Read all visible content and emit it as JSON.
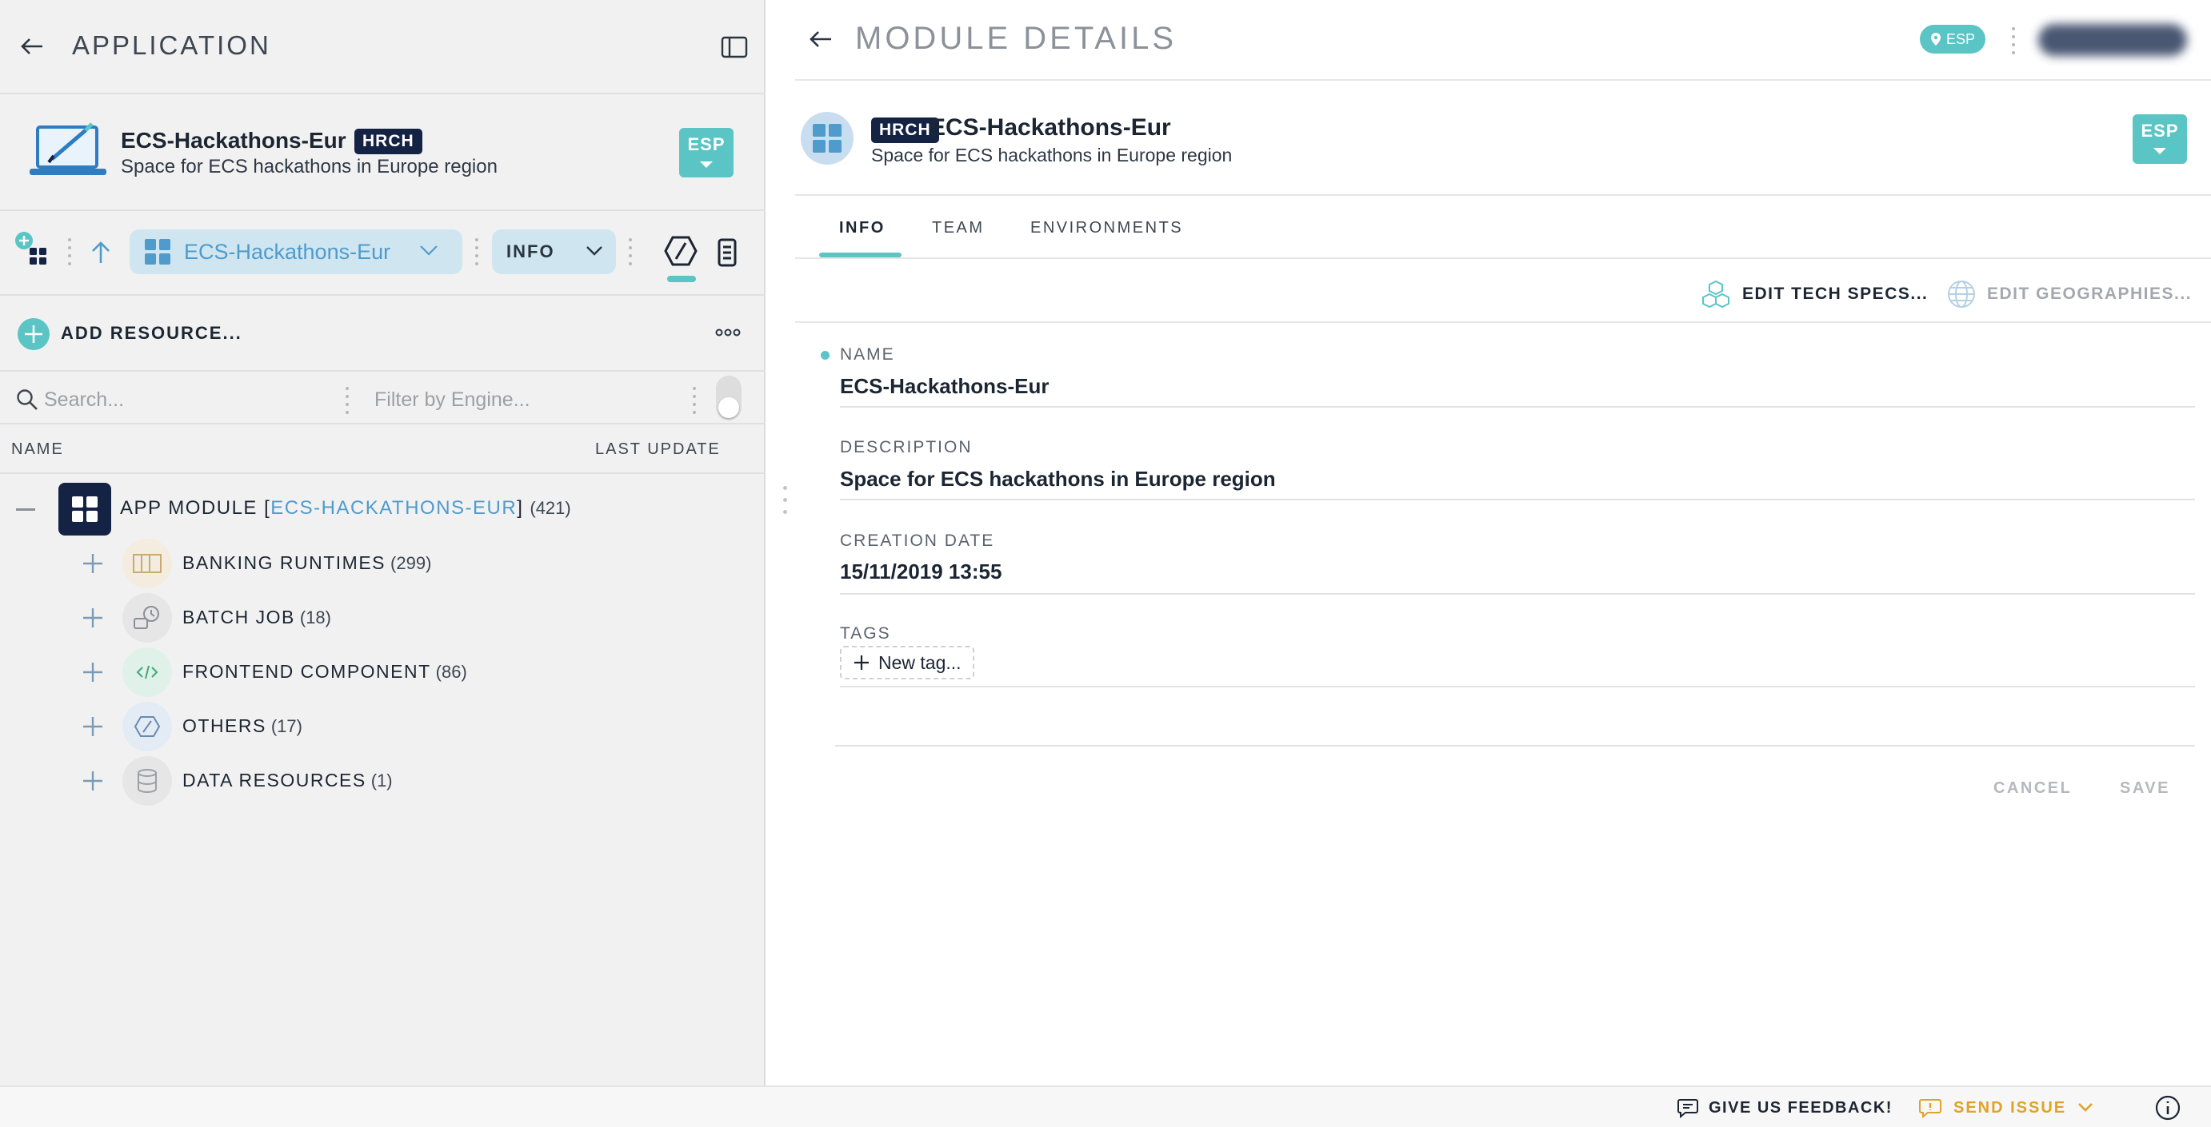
{
  "left_panel": {
    "header_title": "APPLICATION",
    "app": {
      "name": "ECS-Hackathons-Eur",
      "badge": "HRCH",
      "description": "Space for ECS hackathons in Europe region",
      "region_button": "ESP"
    },
    "toolbar": {
      "module_select_value": "ECS-Hackathons-Eur",
      "view_select_value": "INFO"
    },
    "add_resource_label": "ADD RESOURCE...",
    "search": {
      "placeholder": "Search..."
    },
    "filter": {
      "placeholder": "Filter by Engine..."
    },
    "columns": {
      "name": "NAME",
      "last_update": "LAST UPDATE"
    },
    "tree": {
      "root": {
        "prefix": "APP MODULE [",
        "link": "ECS-HACKATHONS-EUR",
        "suffix": "]",
        "count": "(421)"
      },
      "items": [
        {
          "label": "BANKING RUNTIMES",
          "count": "(299)",
          "icon": "banking-runtimes-icon"
        },
        {
          "label": "BATCH JOB",
          "count": "(18)",
          "icon": "batch-job-icon"
        },
        {
          "label": "FRONTEND COMPONENT",
          "count": "(86)",
          "icon": "code-icon"
        },
        {
          "label": "OTHERS",
          "count": "(17)",
          "icon": "hexagon-icon"
        },
        {
          "label": "DATA RESOURCES",
          "count": "(1)",
          "icon": "database-icon"
        }
      ]
    }
  },
  "right_panel": {
    "header_title": "MODULE DETAILS",
    "region_chip": "ESP",
    "module": {
      "badge": "HRCH",
      "name": "ECS-Hackathons-Eur",
      "description": "Space for ECS hackathons in Europe region",
      "region_button": "ESP"
    },
    "tabs": [
      {
        "label": "INFO",
        "active": true
      },
      {
        "label": "TEAM",
        "active": false
      },
      {
        "label": "ENVIRONMENTS",
        "active": false
      }
    ],
    "actions": {
      "edit_tech_specs": "EDIT TECH SPECS...",
      "edit_geographies": "EDIT GEOGRAPHIES..."
    },
    "fields": {
      "name_label": "NAME",
      "name_value": "ECS-Hackathons-Eur",
      "description_label": "DESCRIPTION",
      "description_value": "Space for ECS hackathons in Europe region",
      "creation_date_label": "CREATION DATE",
      "creation_date_value": "15/11/2019 13:55",
      "tags_label": "TAGS",
      "new_tag_label": "New tag..."
    },
    "buttons": {
      "cancel": "CANCEL",
      "save": "SAVE"
    }
  },
  "status_bar": {
    "feedback": "GIVE US FEEDBACK!",
    "send_issue": "SEND ISSUE"
  },
  "colors": {
    "accent": "#5bc4c4",
    "link": "#4f9bcc",
    "badge_dark": "#142244",
    "warning": "#e0a22a"
  }
}
